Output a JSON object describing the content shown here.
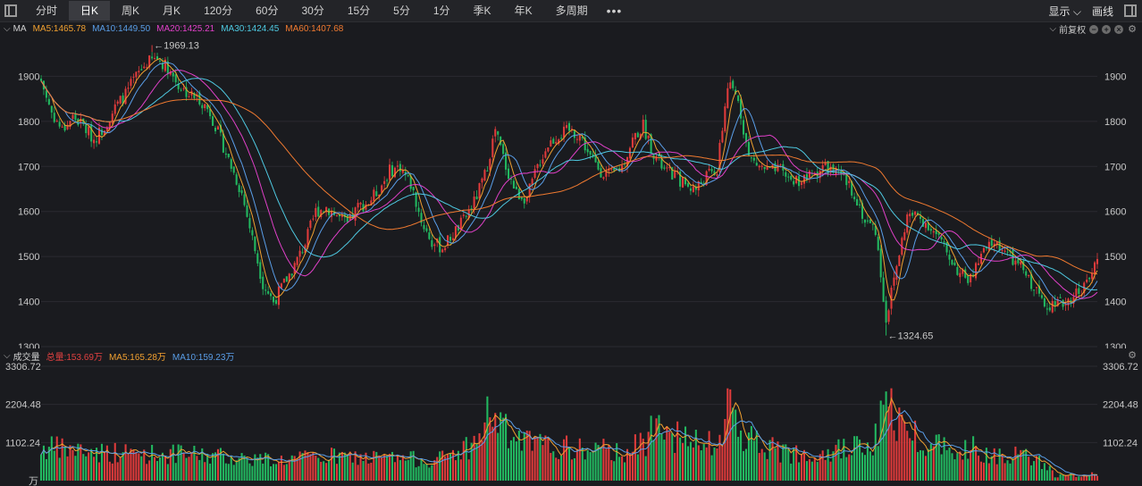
{
  "toolbar": {
    "tabs": [
      "分时",
      "日K",
      "周K",
      "月K",
      "120分",
      "60分",
      "30分",
      "15分",
      "5分",
      "1分",
      "季K",
      "年K",
      "多周期"
    ],
    "active_tab": "日K",
    "display_label": "显示",
    "draw_label": "画线"
  },
  "price_panel": {
    "indicator": "MA",
    "ma": [
      {
        "label": "MA5:1465.78",
        "color": "#f0a030"
      },
      {
        "label": "MA10:1449.50",
        "color": "#5a9ee8"
      },
      {
        "label": "MA20:1425.21",
        "color": "#e040c8"
      },
      {
        "label": "MA30:1424.45",
        "color": "#4ec8e0"
      },
      {
        "label": "MA60:1407.68",
        "color": "#f07a30"
      }
    ],
    "adjust_label": "前复权",
    "y_ticks": [
      "1900",
      "1800",
      "1700",
      "1600",
      "1500",
      "1400",
      "1300"
    ],
    "high_label": "1969.13",
    "low_label": "1324.65"
  },
  "volume_panel": {
    "title": "成交量",
    "total": {
      "label": "总量:153.69万",
      "color": "#e04040"
    },
    "ma5": {
      "label": "MA5:165.28万",
      "color": "#f0a030"
    },
    "ma10": {
      "label": "MA10:159.23万",
      "color": "#5a9ee8"
    },
    "y_ticks": [
      "3306.72",
      "2204.48",
      "1102.24"
    ],
    "unit": "万"
  },
  "colors": {
    "up": "#e03b3b",
    "down": "#22b860",
    "background": "#1a1b1f",
    "grid": "#2a2b30"
  },
  "chart_data": {
    "type": "candlestick",
    "price_range": [
      1300,
      1990
    ],
    "volume_range": [
      0,
      3306.72
    ],
    "price_anchors": [
      [
        0,
        1890
      ],
      [
        4,
        1820
      ],
      [
        8,
        1780
      ],
      [
        12,
        1810
      ],
      [
        16,
        1790
      ],
      [
        20,
        1760
      ],
      [
        24,
        1790
      ],
      [
        28,
        1830
      ],
      [
        32,
        1860
      ],
      [
        36,
        1900
      ],
      [
        40,
        1930
      ],
      [
        44,
        1940
      ],
      [
        48,
        1920
      ],
      [
        52,
        1880
      ],
      [
        56,
        1860
      ],
      [
        60,
        1850
      ],
      [
        64,
        1820
      ],
      [
        68,
        1760
      ],
      [
        72,
        1700
      ],
      [
        76,
        1640
      ],
      [
        80,
        1540
      ],
      [
        84,
        1440
      ],
      [
        88,
        1400
      ],
      [
        92,
        1440
      ],
      [
        96,
        1480
      ],
      [
        100,
        1530
      ],
      [
        104,
        1600
      ],
      [
        108,
        1610
      ],
      [
        112,
        1590
      ],
      [
        116,
        1570
      ],
      [
        120,
        1610
      ],
      [
        124,
        1620
      ],
      [
        128,
        1650
      ],
      [
        132,
        1690
      ],
      [
        136,
        1700
      ],
      [
        140,
        1660
      ],
      [
        144,
        1580
      ],
      [
        148,
        1530
      ],
      [
        152,
        1520
      ],
      [
        156,
        1550
      ],
      [
        160,
        1580
      ],
      [
        164,
        1620
      ],
      [
        168,
        1680
      ],
      [
        172,
        1780
      ],
      [
        176,
        1700
      ],
      [
        180,
        1640
      ],
      [
        184,
        1630
      ],
      [
        188,
        1700
      ],
      [
        192,
        1750
      ],
      [
        196,
        1770
      ],
      [
        200,
        1780
      ],
      [
        204,
        1770
      ],
      [
        208,
        1720
      ],
      [
        212,
        1690
      ],
      [
        216,
        1680
      ],
      [
        220,
        1700
      ],
      [
        224,
        1760
      ],
      [
        228,
        1790
      ],
      [
        232,
        1730
      ],
      [
        236,
        1690
      ],
      [
        240,
        1680
      ],
      [
        244,
        1660
      ],
      [
        248,
        1650
      ],
      [
        252,
        1680
      ],
      [
        256,
        1690
      ],
      [
        260,
        1880
      ],
      [
        264,
        1850
      ],
      [
        268,
        1720
      ],
      [
        272,
        1700
      ],
      [
        276,
        1690
      ],
      [
        280,
        1690
      ],
      [
        284,
        1670
      ],
      [
        288,
        1670
      ],
      [
        292,
        1680
      ],
      [
        296,
        1700
      ],
      [
        300,
        1690
      ],
      [
        304,
        1670
      ],
      [
        308,
        1640
      ],
      [
        312,
        1580
      ],
      [
        316,
        1560
      ],
      [
        320,
        1360
      ],
      [
        324,
        1480
      ],
      [
        328,
        1590
      ],
      [
        332,
        1590
      ],
      [
        336,
        1570
      ],
      [
        340,
        1540
      ],
      [
        344,
        1500
      ],
      [
        348,
        1460
      ],
      [
        352,
        1450
      ],
      [
        356,
        1500
      ],
      [
        360,
        1530
      ],
      [
        364,
        1520
      ],
      [
        368,
        1490
      ],
      [
        372,
        1470
      ],
      [
        376,
        1430
      ],
      [
        380,
        1400
      ],
      [
        384,
        1390
      ],
      [
        388,
        1400
      ],
      [
        392,
        1420
      ],
      [
        396,
        1440
      ],
      [
        400,
        1490
      ]
    ],
    "volume_anchors": [
      [
        0,
        950
      ],
      [
        30,
        800
      ],
      [
        60,
        750
      ],
      [
        90,
        600
      ],
      [
        110,
        700
      ],
      [
        130,
        650
      ],
      [
        150,
        600
      ],
      [
        165,
        1100
      ],
      [
        170,
        2050
      ],
      [
        178,
        1200
      ],
      [
        190,
        1000
      ],
      [
        205,
        900
      ],
      [
        220,
        850
      ],
      [
        230,
        1100
      ],
      [
        233,
        2400
      ],
      [
        240,
        1300
      ],
      [
        250,
        1000
      ],
      [
        258,
        1100
      ],
      [
        260,
        2500
      ],
      [
        265,
        1400
      ],
      [
        280,
        800
      ],
      [
        300,
        900
      ],
      [
        315,
        1000
      ],
      [
        320,
        2250
      ],
      [
        325,
        1700
      ],
      [
        335,
        1100
      ],
      [
        350,
        1000
      ],
      [
        360,
        800
      ],
      [
        370,
        750
      ],
      [
        380,
        500
      ],
      [
        384,
        150
      ],
      [
        400,
        180
      ]
    ],
    "labels": {
      "high": "1969.13",
      "low": "1324.65"
    }
  }
}
